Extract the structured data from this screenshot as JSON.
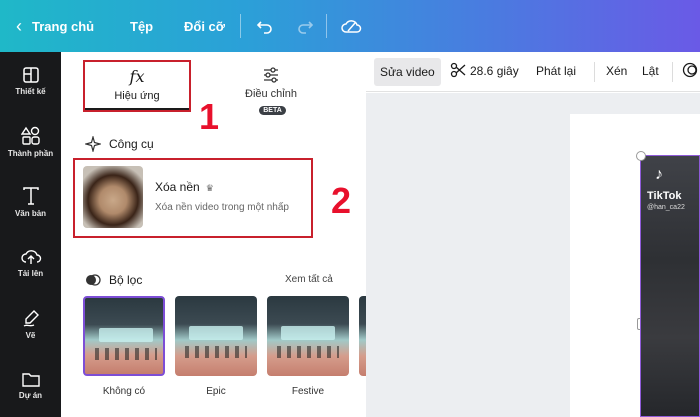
{
  "topbar": {
    "back_label": "Trang chủ",
    "file_label": "Tệp",
    "resize_label": "Đổi cỡ"
  },
  "rail": {
    "items": [
      {
        "label": "Thiết kế",
        "icon": "layout-icon"
      },
      {
        "label": "Thành phần",
        "icon": "elements-icon"
      },
      {
        "label": "Văn bản",
        "icon": "text-icon"
      },
      {
        "label": "Tải lên",
        "icon": "upload-cloud-icon"
      },
      {
        "label": "Vẽ",
        "icon": "draw-icon"
      },
      {
        "label": "Dự án",
        "icon": "folder-icon"
      }
    ]
  },
  "panel": {
    "tabs": [
      {
        "icon": "fx",
        "label": "Hiệu ứng"
      },
      {
        "label": "Điều chỉnh",
        "badge": "BETA"
      }
    ],
    "annotation_1": "1",
    "annotation_2": "2",
    "tools_title": "Công cụ",
    "tool": {
      "name": "Xóa nền",
      "crown": "♛",
      "desc": "Xóa nền video trong một nhấp"
    },
    "filters_title": "Bộ lọc",
    "see_all": "Xem tất cả",
    "filters": [
      {
        "label": "Không có"
      },
      {
        "label": "Epic"
      },
      {
        "label": "Festive"
      }
    ]
  },
  "editor": {
    "edit_video": "Sửa video",
    "duration": "28.6 giây",
    "playback": "Phát lại",
    "crop": "Xén",
    "flip": "Lật"
  },
  "video": {
    "brand": "TikTok",
    "user": "@han_ca22"
  },
  "colors": {
    "annotation_red": "#e8102c",
    "rail_bg": "#18191b",
    "selection_purple": "#7d4ed6"
  }
}
